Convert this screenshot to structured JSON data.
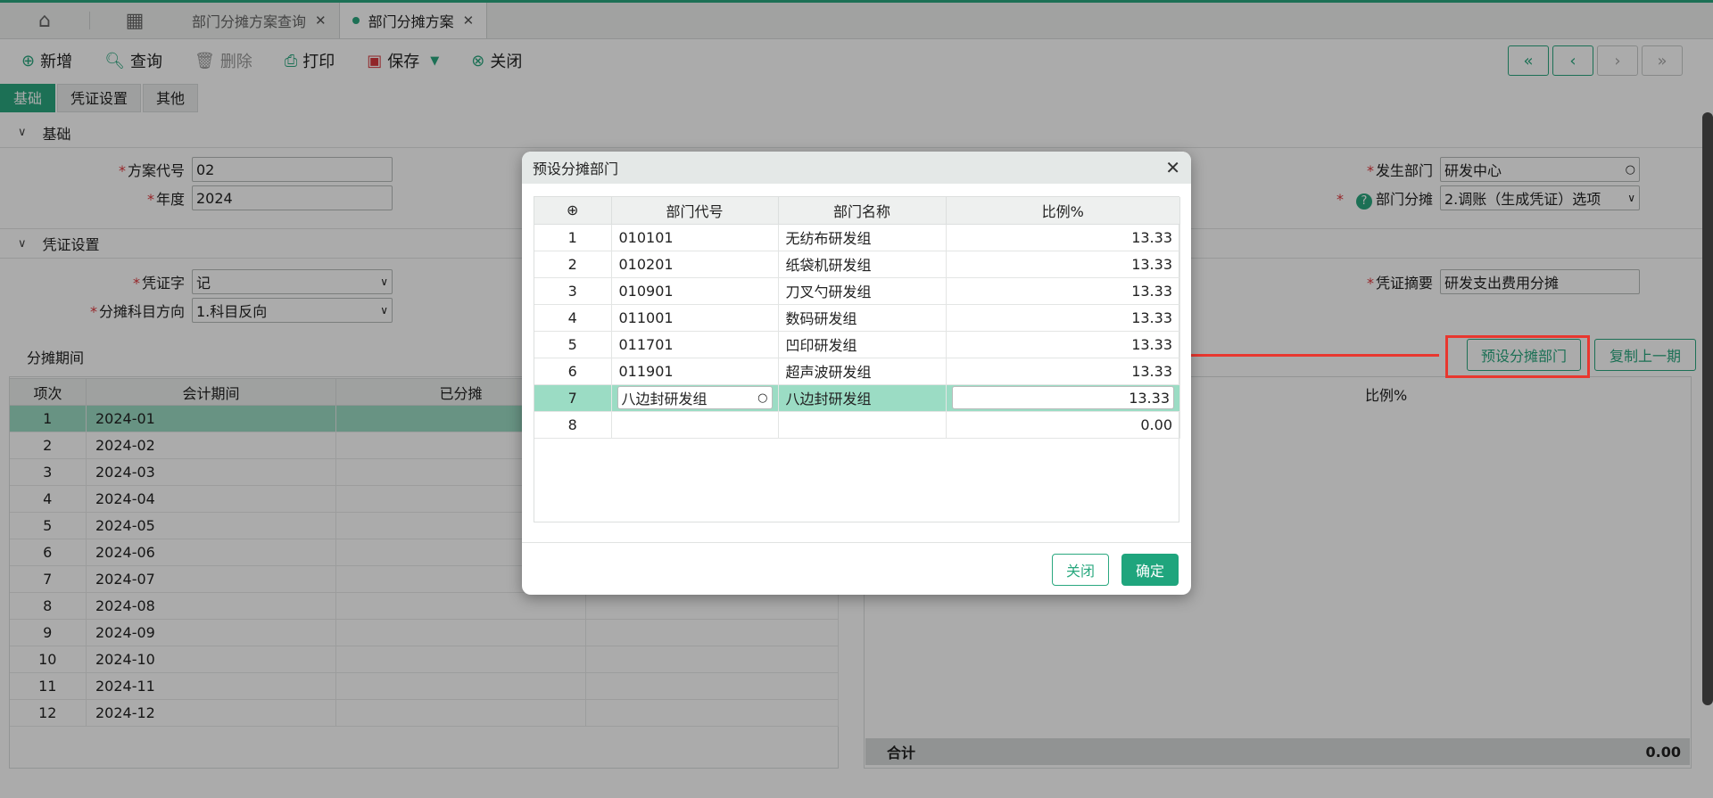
{
  "topbar": {
    "tabs": [
      {
        "label": "部门分摊方案查询",
        "active": false
      },
      {
        "label": "部门分摊方案",
        "active": true
      }
    ]
  },
  "toolbar": {
    "new_label": "新增",
    "query_label": "查询",
    "delete_label": "删除",
    "print_label": "打印",
    "save_label": "保存",
    "close_label": "关闭"
  },
  "subtabs": [
    "基础",
    "凭证设置",
    "其他"
  ],
  "basic": {
    "section_label": "基础",
    "scheme_code_label": "方案代号",
    "scheme_code_value": "02",
    "year_label": "年度",
    "year_value": "2024",
    "dept_label": "发生部门",
    "dept_value": "研发中心",
    "alloc_label": "部门分摊",
    "alloc_value": "2.调账（生成凭证）选项"
  },
  "voucher": {
    "section_label": "凭证设置",
    "word_label": "凭证字",
    "word_value": "记",
    "direction_label": "分摊科目方向",
    "direction_value": "1.科目反向",
    "summary_label": "凭证摘要",
    "summary_value": "研发支出费用分摊"
  },
  "periods": {
    "title": "分摊期间",
    "headers": [
      "项次",
      "会计期间",
      "已分摊"
    ],
    "rows": [
      {
        "idx": "1",
        "period": "2024-01"
      },
      {
        "idx": "2",
        "period": "2024-02"
      },
      {
        "idx": "3",
        "period": "2024-03"
      },
      {
        "idx": "4",
        "period": "2024-04"
      },
      {
        "idx": "5",
        "period": "2024-05"
      },
      {
        "idx": "6",
        "period": "2024-06"
      },
      {
        "idx": "7",
        "period": "2024-07"
      },
      {
        "idx": "8",
        "period": "2024-08"
      },
      {
        "idx": "9",
        "period": "2024-09"
      },
      {
        "idx": "10",
        "period": "2024-10"
      },
      {
        "idx": "11",
        "period": "2024-11"
      },
      {
        "idx": "12",
        "period": "2024-12"
      }
    ]
  },
  "right_panel": {
    "preset_button": "预设分摊部门",
    "copy_button": "复制上一期",
    "ratio_header": "比例%",
    "total_label": "合计",
    "total_value": "0.00"
  },
  "modal": {
    "title": "预设分摊部门",
    "headers": [
      "部门代号",
      "部门名称",
      "比例%"
    ],
    "rows": [
      {
        "idx": "1",
        "code": "010101",
        "name": "无纺布研发组",
        "ratio": "13.33"
      },
      {
        "idx": "2",
        "code": "010201",
        "name": "纸袋机研发组",
        "ratio": "13.33"
      },
      {
        "idx": "3",
        "code": "010901",
        "name": "刀叉勺研发组",
        "ratio": "13.33"
      },
      {
        "idx": "4",
        "code": "011001",
        "name": "数码研发组",
        "ratio": "13.33"
      },
      {
        "idx": "5",
        "code": "011701",
        "name": "凹印研发组",
        "ratio": "13.33"
      },
      {
        "idx": "6",
        "code": "011901",
        "name": "超声波研发组",
        "ratio": "13.33"
      },
      {
        "idx": "7",
        "code": "八边封研发组",
        "name": "八边封研发组",
        "ratio": "13.33"
      },
      {
        "idx": "8",
        "code": "",
        "name": "",
        "ratio": "0.00"
      }
    ],
    "close_label": "关闭",
    "ok_label": "确定"
  },
  "colors": {
    "accent": "#2aa87f",
    "highlight": "#9bdcc4",
    "annotation": "#e8372f"
  }
}
